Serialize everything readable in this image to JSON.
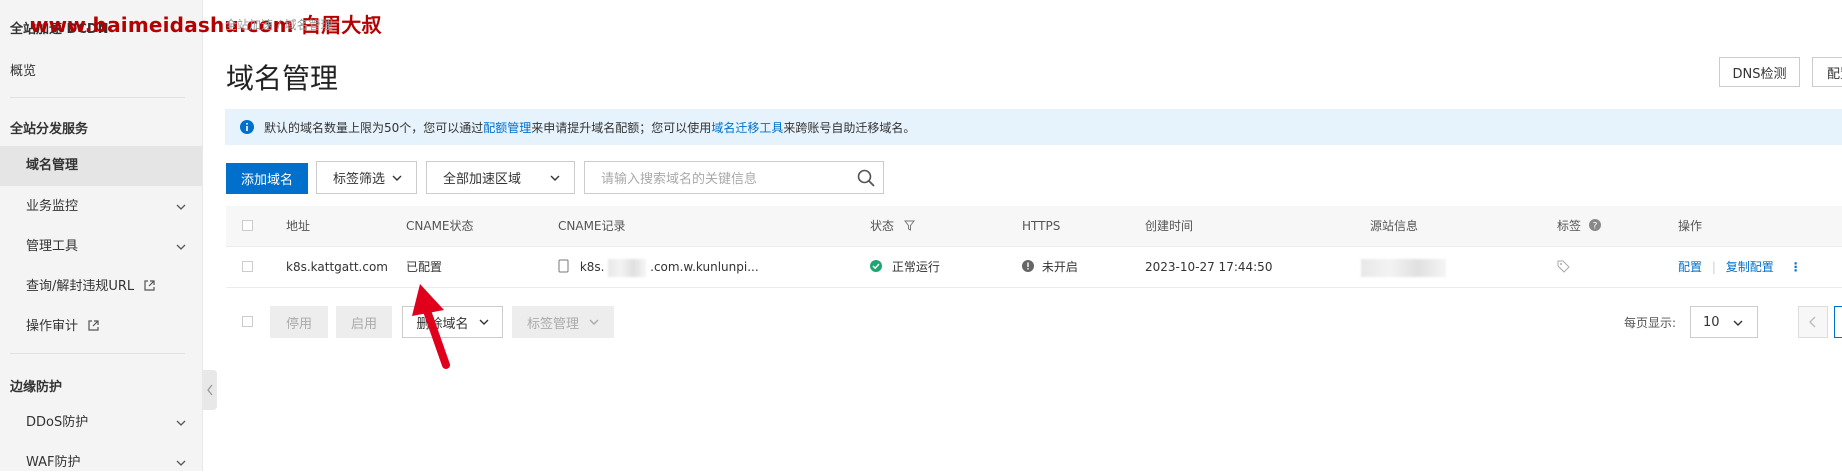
{
  "watermark": "www.baimeidashu.com 白眉大叔",
  "sidebar": {
    "title": "全站加速 DCDN",
    "overview": "概览",
    "section1": "全站分发服务",
    "items": [
      {
        "label": "域名管理"
      },
      {
        "label": "业务监控"
      },
      {
        "label": "管理工具"
      },
      {
        "label": "查询/解封违规URL"
      },
      {
        "label": "操作审计"
      }
    ],
    "section2": "边缘防护",
    "items2": [
      {
        "label": "DDoS防护"
      },
      {
        "label": "WAF防护"
      }
    ]
  },
  "breadcrumb": "全站加速 / 域名管理",
  "page_title": "域名管理",
  "header_buttons": {
    "dns_check": "DNS检测",
    "config": "配置"
  },
  "notice": {
    "part1": "默认的域名数量上限为50个，您可以通过",
    "link1": "配额管理",
    "part2": "来申请提升域名配额；您可以使用",
    "link2": "域名迁移工具",
    "part3": "来跨账号自助迁移域名。"
  },
  "toolbar": {
    "add_domain": "添加域名",
    "tag_filter": "标签筛选",
    "region": "全部加速区域",
    "search_placeholder": "请输入搜索域名的关键信息"
  },
  "table": {
    "headers": {
      "address": "地址",
      "cname_status": "CNAME状态",
      "cname_record": "CNAME记录",
      "status": "状态",
      "https": "HTTPS",
      "created": "创建时间",
      "origin": "源站信息",
      "tags": "标签",
      "ops": "操作"
    },
    "rows": [
      {
        "address": "k8s.kattgatt.com",
        "cname_status": "已配置",
        "cname_prefix": "k8s.",
        "cname_suffix": ".com.w.kunlunpi...",
        "status": "正常运行",
        "https": "未开启",
        "created": "2023-10-27 17:44:50",
        "op_config": "配置",
        "op_copy": "复制配置"
      }
    ]
  },
  "bulk": {
    "disable": "停用",
    "enable": "启用",
    "delete": "删除域名",
    "tags": "标签管理"
  },
  "pagination": {
    "per_page_label": "每页显示:",
    "per_page_value": "10"
  },
  "colors": {
    "primary": "#0070cc",
    "success": "#1ea672",
    "arrow": "#e0001b"
  }
}
